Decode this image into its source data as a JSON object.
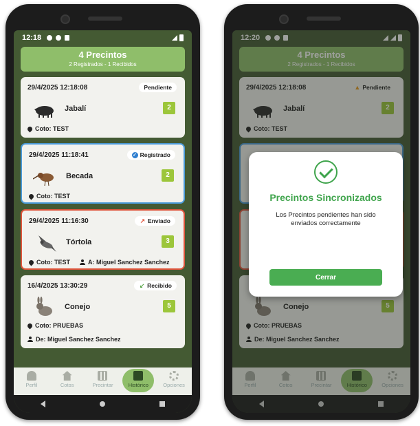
{
  "colors": {
    "background": "#445a33",
    "header": "#8fbe6a",
    "registrado_border": "#4a9ad8",
    "enviado_border": "#e0553c",
    "count_badge": "#9cc63a",
    "success": "#3fa44c"
  },
  "left_phone": {
    "status_time": "12:18",
    "header": {
      "title": "4 Precintos",
      "subtitle": "2 Registrados - 1 Recibidos"
    },
    "cards": [
      {
        "date": "29/4/2025 12:18:08",
        "status": "Pendiente",
        "status_icon": "none",
        "species": "Jabalí",
        "animal_icon": "boar-icon",
        "count": "2",
        "coto": "Coto: TEST",
        "extra": ""
      },
      {
        "date": "29/4/2025 11:18:41",
        "status": "Registrado",
        "status_icon": "check-circle-icon",
        "species": "Becada",
        "animal_icon": "woodcock-icon",
        "count": "2",
        "coto": "Coto: TEST",
        "extra": ""
      },
      {
        "date": "29/4/2025 11:16:30",
        "status": "Enviado",
        "status_icon": "arrow-up-right-icon",
        "species": "Tórtola",
        "animal_icon": "dove-icon",
        "count": "3",
        "coto": "Coto: TEST",
        "extra": "A: Miguel Sanchez Sanchez"
      },
      {
        "date": "16/4/2025 13:30:29",
        "status": "Recibido",
        "status_icon": "arrow-down-left-icon",
        "species": "Conejo",
        "animal_icon": "rabbit-icon",
        "count": "5",
        "coto": "Coto: PRUEBAS",
        "extra": "De: Miguel Sanchez Sanchez"
      }
    ],
    "nav": [
      {
        "label": "Perfil",
        "icon": "user-icon"
      },
      {
        "label": "Cotos",
        "icon": "home-icon"
      },
      {
        "label": "Precintar",
        "icon": "qr-icon"
      },
      {
        "label": "Histórico",
        "icon": "calendar-icon",
        "active": true
      },
      {
        "label": "Opciones",
        "icon": "gear-icon"
      }
    ]
  },
  "right_phone": {
    "status_time": "12:20",
    "header": {
      "title": "4 Precintos",
      "subtitle": "2 Registrados - 1 Recibidos"
    },
    "card_top": {
      "date": "29/4/2025 12:18:08",
      "status": "Pendiente",
      "status_icon": "warning-icon",
      "species": "Jabalí",
      "count": "2",
      "coto": "Coto: TEST"
    },
    "card_bottom": {
      "species": "Conejo",
      "count": "5",
      "coto": "Coto: PRUEBAS",
      "extra": "De: Miguel Sanchez Sanchez"
    },
    "dialog": {
      "title": "Precintos Sincronizados",
      "message": "Los Precintos pendientes han sido enviados correctamente",
      "button": "Cerrar"
    },
    "nav": [
      {
        "label": "Perfil"
      },
      {
        "label": "Cotos"
      },
      {
        "label": "Precintar"
      },
      {
        "label": "Histórico",
        "active": true
      },
      {
        "label": "Opciones"
      }
    ]
  }
}
